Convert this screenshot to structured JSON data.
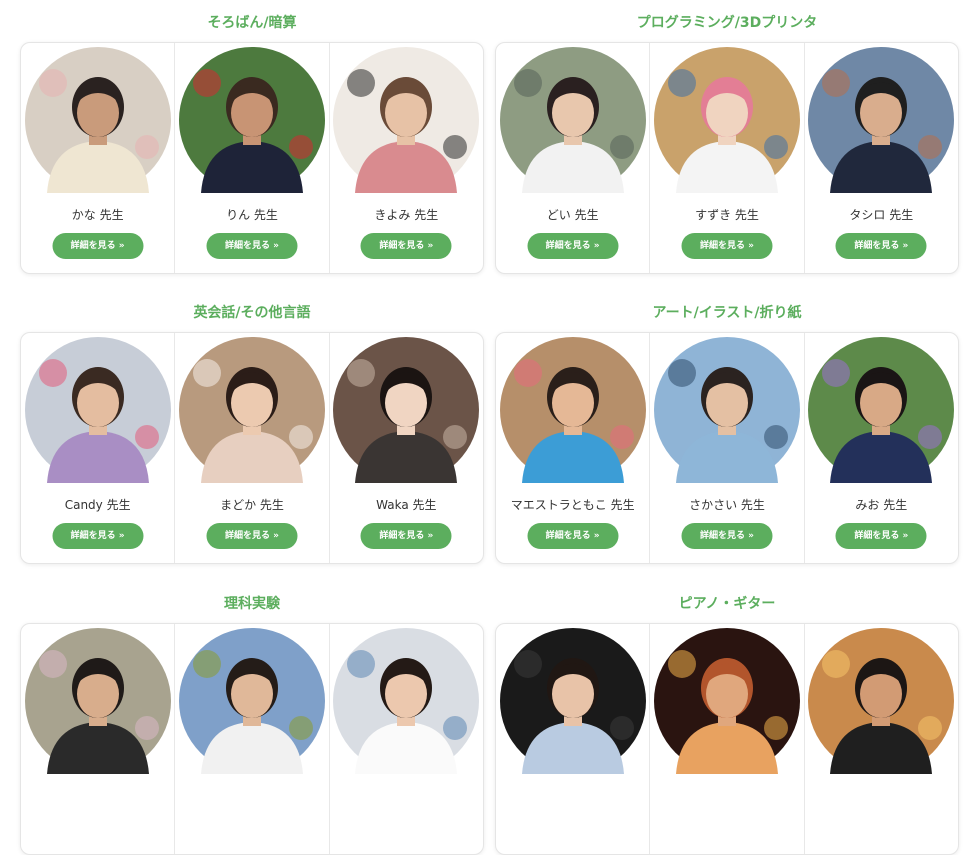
{
  "sections": [
    {
      "title": "そろばん/暗算",
      "teachers": [
        {
          "name": "かな 先生",
          "button": "詳細を見る »",
          "colors": {
            "bg": "#d8cfc4",
            "skin": "#c99b7b",
            "hair": "#2a2220",
            "cloth": "#efe6d2",
            "accent": "#e7b3b3"
          }
        },
        {
          "name": "りん 先生",
          "button": "詳細を見る »",
          "colors": {
            "bg": "#4d7a3e",
            "skin": "#c89474",
            "hair": "#3a2a20",
            "cloth": "#1e2338",
            "accent": "#d42a32"
          }
        },
        {
          "name": "きよみ 先生",
          "button": "詳細を見る »",
          "colors": {
            "bg": "#efeae4",
            "skin": "#e7c2a6",
            "hair": "#6a4b38",
            "cloth": "#d98b8f",
            "accent": "#2b2b2b"
          }
        }
      ]
    },
    {
      "title": "プログラミング/3Dプリンタ",
      "teachers": [
        {
          "name": "どい 先生",
          "button": "詳細を見る »",
          "colors": {
            "bg": "#8e9c82",
            "skin": "#e8c7ad",
            "hair": "#2a2020",
            "cloth": "#f2f2f2",
            "accent": "#55625a"
          }
        },
        {
          "name": "すずき 先生",
          "button": "詳細を見る »",
          "colors": {
            "bg": "#c9a26b",
            "skin": "#f0d4c0",
            "hair": "#e37e95",
            "cloth": "#f4f4f4",
            "accent": "#3d70a8"
          }
        },
        {
          "name": "タシロ 先生",
          "button": "詳細を見る »",
          "colors": {
            "bg": "#6f88a6",
            "skin": "#d9ad8d",
            "hair": "#1f1f1f",
            "cloth": "#20283c",
            "accent": "#b76f4a"
          }
        }
      ]
    },
    {
      "title": "英会話/その他言語",
      "teachers": [
        {
          "name": "Candy 先生",
          "button": "詳細を見る »",
          "colors": {
            "bg": "#c7cdd7",
            "skin": "#e4bda0",
            "hair": "#3a2a22",
            "cloth": "#a98ec4",
            "accent": "#e25c7b"
          }
        },
        {
          "name": "まどか 先生",
          "button": "詳細を見る »",
          "colors": {
            "bg": "#b89a7e",
            "skin": "#eccab0",
            "hair": "#2b1d18",
            "cloth": "#e7cfc0",
            "accent": "#f5eee8"
          }
        },
        {
          "name": "Waka 先生",
          "button": "詳細を見る »",
          "colors": {
            "bg": "#6b5448",
            "skin": "#f0d5c2",
            "hair": "#1b1412",
            "cloth": "#3a3533",
            "accent": "#c9b4a6"
          }
        }
      ]
    },
    {
      "title": "アート/イラスト/折り紙",
      "teachers": [
        {
          "name": "マエストラともこ 先生",
          "button": "詳細を見る »",
          "colors": {
            "bg": "#b68f6a",
            "skin": "#e5b896",
            "hair": "#2a1f1a",
            "cloth": "#3c9dd6",
            "accent": "#e66b7c"
          }
        },
        {
          "name": "さかさい 先生",
          "button": "詳細を見る »",
          "colors": {
            "bg": "#8fb4d6",
            "skin": "#e4c0a3",
            "hair": "#2b2320",
            "cloth": "#8eb6d8",
            "accent": "#2f4d6c"
          }
        },
        {
          "name": "みお 先生",
          "button": "詳細を見る »",
          "colors": {
            "bg": "#5d8a4a",
            "skin": "#d8a986",
            "hair": "#1a1515",
            "cloth": "#23305a",
            "accent": "#9a6fd1"
          }
        }
      ]
    },
    {
      "title": "理科実験",
      "teachers": [
        {
          "name": "",
          "button": "",
          "colors": {
            "bg": "#a8a38f",
            "skin": "#d8ad8c",
            "hair": "#1f1a18",
            "cloth": "#2a2a2a",
            "accent": "#d9b8c6"
          }
        },
        {
          "name": "",
          "button": "",
          "colors": {
            "bg": "#7fa0c9",
            "skin": "#e0b899",
            "hair": "#241c18",
            "cloth": "#f1f1f1",
            "accent": "#8a9c2f"
          }
        },
        {
          "name": "",
          "button": "",
          "colors": {
            "bg": "#d9dde3",
            "skin": "#ecc8ae",
            "hair": "#241a16",
            "cloth": "#fafafa",
            "accent": "#5d87b5"
          }
        }
      ]
    },
    {
      "title": "ピアノ・ギター",
      "teachers": [
        {
          "name": "",
          "button": "",
          "colors": {
            "bg": "#1a1a1a",
            "skin": "#e8c3a8",
            "hair": "#201713",
            "cloth": "#b9cbe1",
            "accent": "#3a3a3a"
          }
        },
        {
          "name": "",
          "button": "",
          "colors": {
            "bg": "#2a1410",
            "skin": "#e0a77d",
            "hair": "#b2552c",
            "cloth": "#e8a260",
            "accent": "#f2b04a"
          }
        },
        {
          "name": "",
          "button": "",
          "colors": {
            "bg": "#c98a4c",
            "skin": "#d29b74",
            "hair": "#1c1614",
            "cloth": "#1f1f1f",
            "accent": "#f5c46a"
          }
        }
      ]
    }
  ]
}
